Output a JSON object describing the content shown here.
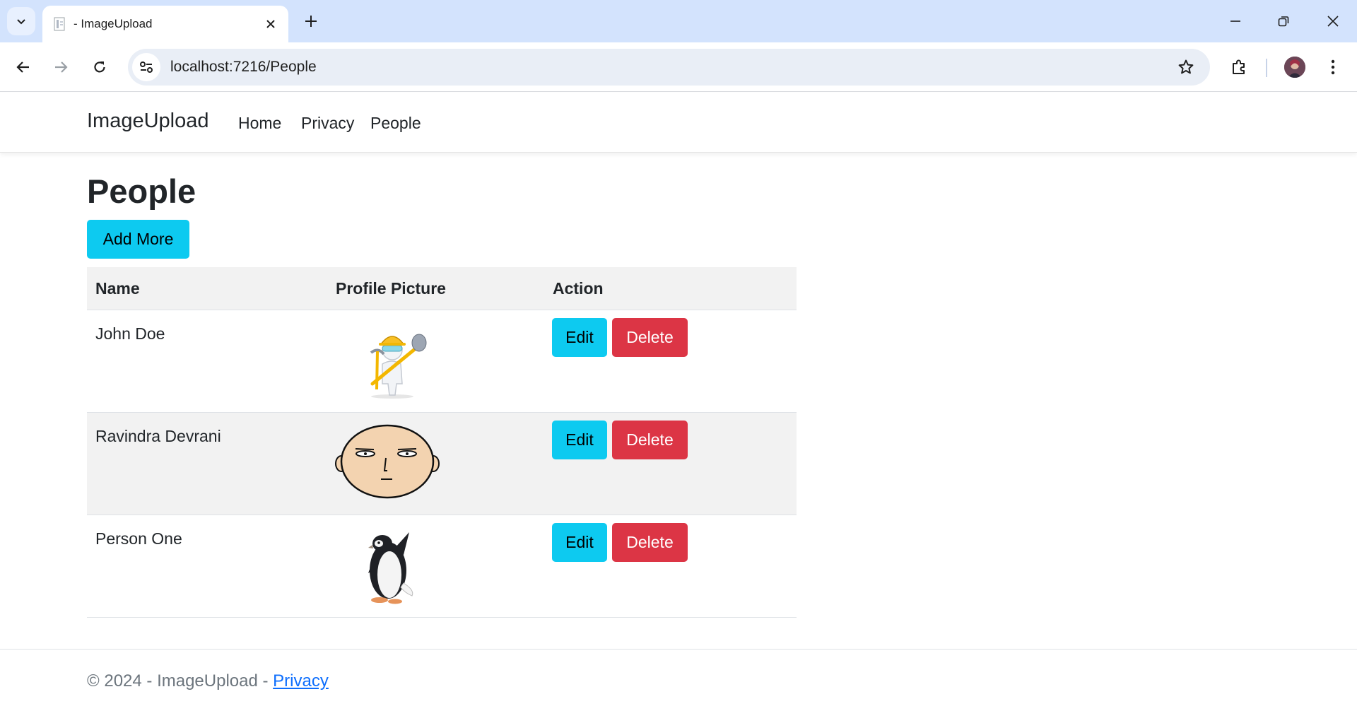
{
  "browser": {
    "tab_title": "- ImageUpload",
    "url": "localhost:7216/People"
  },
  "site": {
    "brand": "ImageUpload",
    "nav": [
      "Home",
      "Privacy",
      "People"
    ]
  },
  "page": {
    "title": "People",
    "add_button": "Add More"
  },
  "table": {
    "headers": [
      "Name",
      "Profile Picture",
      "Action"
    ],
    "rows": [
      {
        "name": "John Doe",
        "picture": "construction-worker-icon",
        "edit": "Edit",
        "delete": "Delete"
      },
      {
        "name": "Ravindra Devrani",
        "picture": "bald-face-icon",
        "edit": "Edit",
        "delete": "Delete"
      },
      {
        "name": "Person One",
        "picture": "penguin-icon",
        "edit": "Edit",
        "delete": "Delete"
      }
    ]
  },
  "footer": {
    "text": "© 2024 - ImageUpload - ",
    "link": "Privacy"
  },
  "colors": {
    "info": "#0dcaf0",
    "danger": "#dc3545",
    "link": "#0d6efd"
  }
}
